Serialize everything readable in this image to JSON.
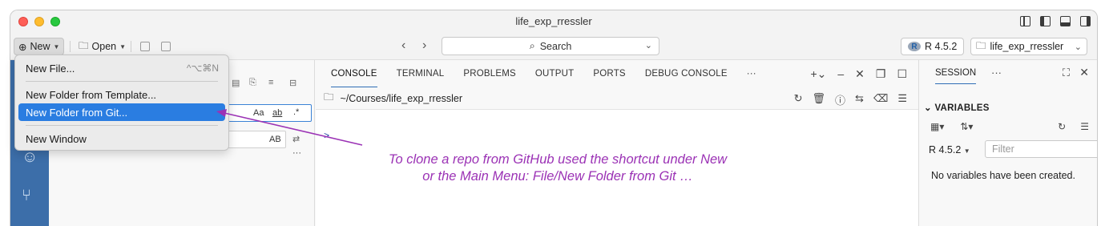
{
  "window": {
    "title": "life_exp_rressler"
  },
  "toolbar": {
    "new_label": "New",
    "open_label": "Open",
    "search_label": "Search",
    "r_version": "R 4.5.2",
    "project": "life_exp_rressler"
  },
  "new_menu": {
    "items": [
      {
        "label": "New File...",
        "shortcut": "^⌥⌘N"
      },
      {
        "label": "New Folder from Template..."
      },
      {
        "label": "New Folder from Git..."
      },
      {
        "label": "New Window"
      }
    ],
    "selected": "New Folder from Git..."
  },
  "panel": {
    "tabs": [
      "CONSOLE",
      "TERMINAL",
      "PROBLEMS",
      "OUTPUT",
      "PORTS",
      "DEBUG CONSOLE"
    ],
    "active_tab": "CONSOLE",
    "more": "···",
    "path": "~/Courses/life_exp_rressler",
    "prompt": ">"
  },
  "explorer": {
    "case_option": "Aa",
    "word_option": "ab",
    "regex_option": ".*",
    "preserve_case": "AB",
    "more": "···"
  },
  "annotation": {
    "line1": "To clone a repo from GitHub used the shortcut under New",
    "line2": "or the Main Menu: File/New Folder from Git …"
  },
  "session": {
    "tab": "SESSION",
    "more": "···",
    "variables_header": "VARIABLES",
    "r_version": "R 4.5.2",
    "filter_placeholder": "Filter",
    "empty_message": "No variables have been created."
  },
  "colors": {
    "activity_bar": "#3c6ea9",
    "menu_selection": "#2a7de1",
    "annotation": "#9b32b5"
  }
}
